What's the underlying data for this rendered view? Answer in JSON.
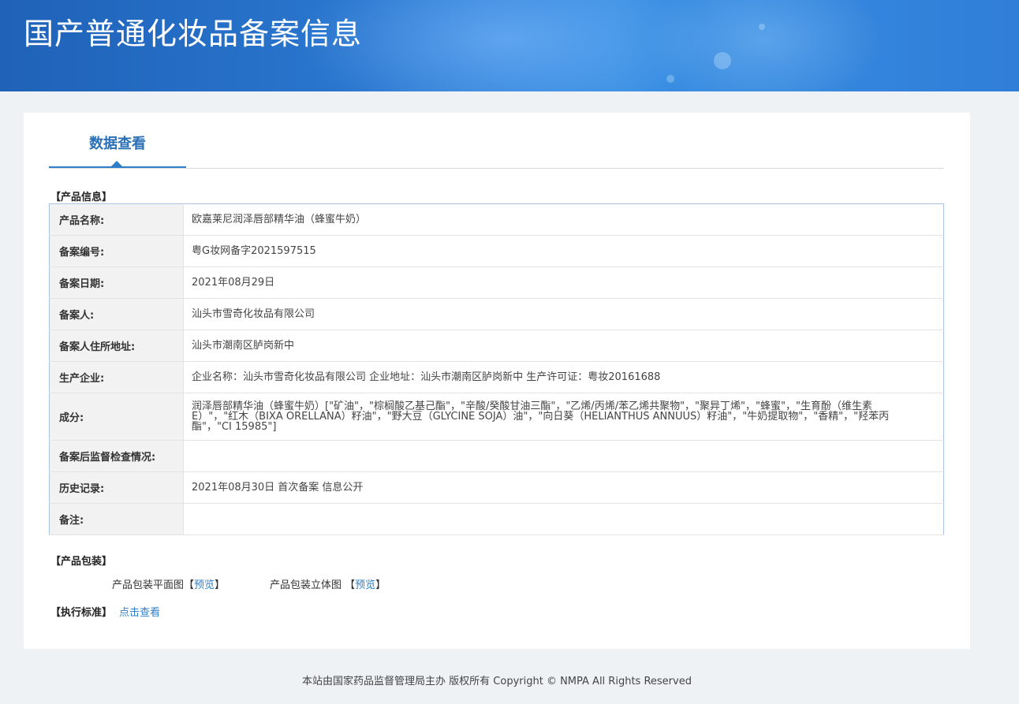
{
  "header": {
    "title": "国产普通化妆品备案信息"
  },
  "tabs": [
    {
      "label": "数据查看",
      "active": true
    }
  ],
  "product_info": {
    "section_title": "【产品信息】",
    "rows": [
      {
        "label": "产品名称:",
        "value": "欧嘉莱尼润泽唇部精华油（蜂蜜牛奶）"
      },
      {
        "label": "备案编号:",
        "value": "粤G妆网备字2021597515"
      },
      {
        "label": "备案日期:",
        "value": "2021年08月29日"
      },
      {
        "label": "备案人:",
        "value": "汕头市雪奇化妆品有限公司"
      },
      {
        "label": "备案人住所地址:",
        "value": "汕头市潮南区胪岗新中"
      },
      {
        "label": "生产企业:",
        "value": "企业名称：汕头市雪奇化妆品有限公司 企业地址：汕头市潮南区胪岗新中 生产许可证：粤妆20161688"
      },
      {
        "label": "成分:",
        "value": "润泽唇部精华油（蜂蜜牛奶）[\"矿油\"，\"棕榈酸乙基己酯\"，\"辛酸/癸酸甘油三酯\"，\"乙烯/丙烯/苯乙烯共聚物\"，\"聚异丁烯\"，\"蜂蜜\"，\"生育酚（维生素E）\"，\"红木（BIXA ORELLANA）籽油\"，\"野大豆（GLYCINE SOJA）油\"，\"向日葵（HELIANTHUS ANNUUS）籽油\"，\"牛奶提取物\"，\"香精\"，\"羟苯丙酯\"，\"CI 15985\"]"
      },
      {
        "label": "备案后监督检查情况:",
        "value": ""
      },
      {
        "label": "历史记录:",
        "value": "2021年08月30日 首次备案 信息公开"
      },
      {
        "label": "备注:",
        "value": ""
      }
    ]
  },
  "packaging": {
    "section_title": "【产品包装】",
    "flat_label": "产品包装平面图【",
    "flat_link": "预览",
    "flat_close": "】",
    "solid_label": "产品包装立体图 【",
    "solid_link": "预览",
    "solid_close": "】"
  },
  "standard": {
    "section_title": "【执行标准】",
    "link": "点击查看"
  },
  "footer": {
    "text": "本站由国家药品监督管理局主办 版权所有 Copyright © NMPA All Rights Reserved"
  },
  "colors": {
    "banner": "#2a76cf",
    "accent": "#2f7fc8",
    "label_bg": "#f2f2f2"
  }
}
